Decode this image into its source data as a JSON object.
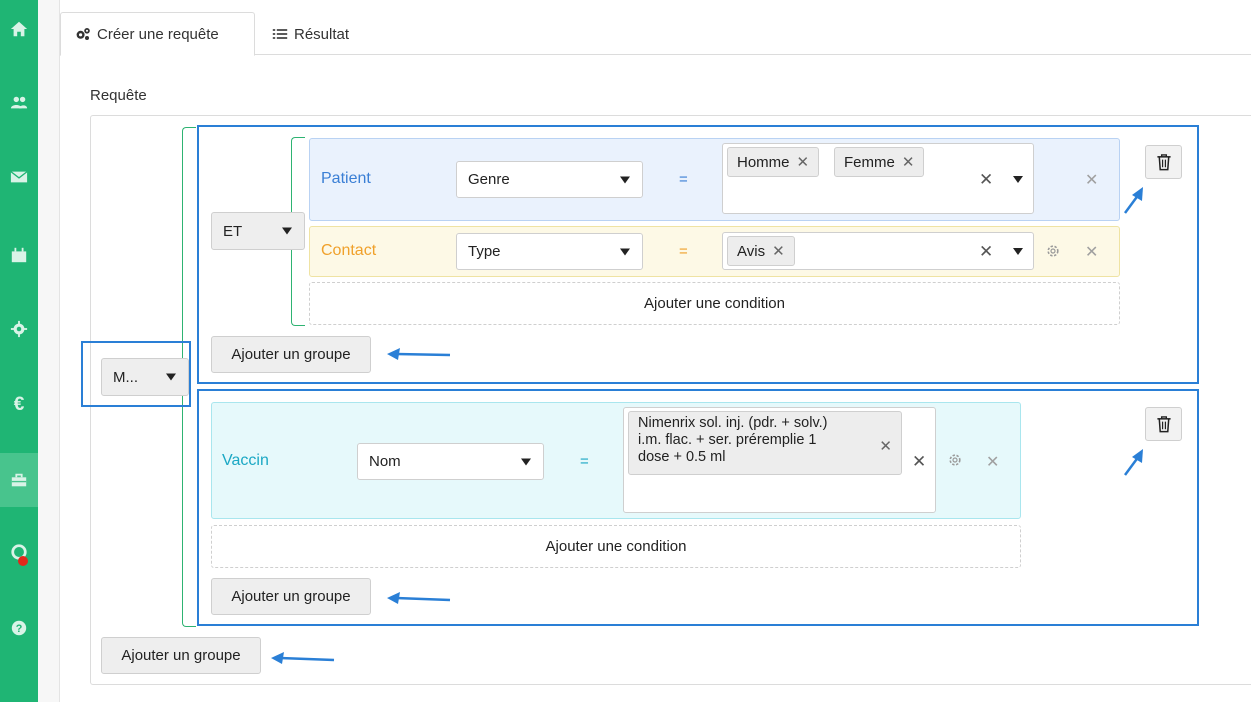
{
  "tabs": [
    {
      "label": "Créer une requête",
      "icon": "gears-icon",
      "active": true
    },
    {
      "label": "Résultat",
      "icon": "list-icon",
      "active": false
    }
  ],
  "query_label": "Requête",
  "root": {
    "operator": "M...",
    "add_group_label": "Ajouter un groupe"
  },
  "group1": {
    "operator": "ET",
    "add_condition_label": "Ajouter une condition",
    "add_group_label": "Ajouter un groupe",
    "rules": [
      {
        "entity": "Patient",
        "field": "Genre",
        "op": "=",
        "values": [
          "Homme",
          "Femme"
        ]
      },
      {
        "entity": "Contact",
        "field": "Type",
        "op": "=",
        "values": [
          "Avis"
        ]
      }
    ]
  },
  "group2": {
    "add_condition_label": "Ajouter une condition",
    "add_group_label": "Ajouter un groupe",
    "rules": [
      {
        "entity": "Vaccin",
        "field": "Nom",
        "op": "=",
        "value_line1": "Nimenrix sol. inj. (pdr. + solv.)",
        "value_line2": "i.m. flac. + ser. préremplie 1",
        "value_line3": "dose + 0.5 ml"
      }
    ]
  },
  "colors": {
    "sidebar": "#1fb574",
    "patient": "#3a7fd5",
    "contact": "#f0a12b",
    "vaccin": "#1ba8c4",
    "highlight": "#2a7fd6",
    "bracket": "#2eb372"
  }
}
